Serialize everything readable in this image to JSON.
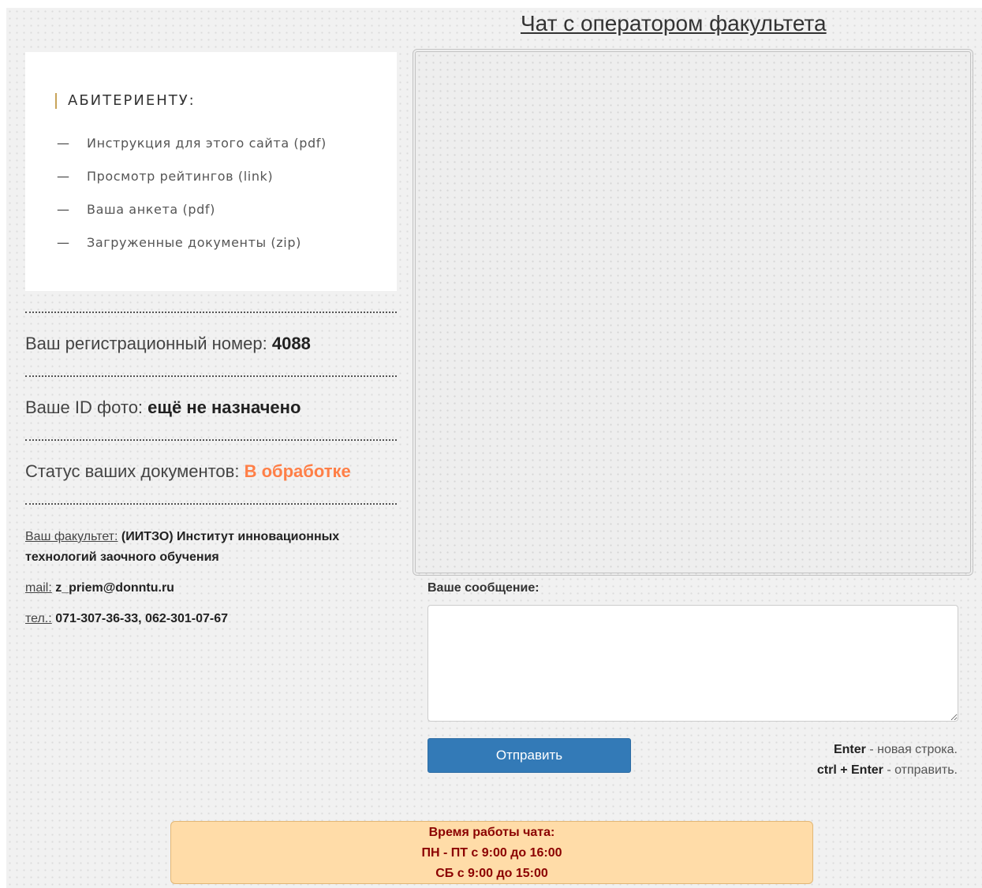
{
  "chat": {
    "title": "Чат с оператором факультета",
    "message_label": "Ваше сообщение:",
    "message_value": "",
    "send_label": "Отправить",
    "hints": [
      {
        "key": "Enter",
        "text": " - новая строка."
      },
      {
        "key": "ctrl + Enter",
        "text": " - отправить."
      }
    ]
  },
  "menu": {
    "heading": "АБИТЕРИЕНТУ:",
    "dash": "—",
    "items": [
      {
        "label": "Инструкция для этого сайта (pdf)"
      },
      {
        "label": "Просмотр рейтингов (link)"
      },
      {
        "label": "Ваша анкета (pdf)"
      },
      {
        "label": "Загруженные документы (zip)"
      }
    ]
  },
  "applicant": {
    "reg_label": "Ваш регистрационный номер: ",
    "reg_value": "4088",
    "photo_label": "Ваше ID фото: ",
    "photo_value": "ещё не назначено",
    "status_label": "Статус ваших документов: ",
    "status_value": "В обработке",
    "faculty_label": "Ваш факультет:",
    "faculty_value": " (ИИТЗО) Институт инновационных технологий заочного обучения",
    "mail_label": "mail:",
    "mail_value": " z_priem@donntu.ru",
    "phone_label": "тел.:",
    "phone_value": " 071-307-36-33, 062-301-07-67"
  },
  "hours": {
    "title": "Время работы чата:",
    "weekdays": "ПН - ПТ с 9:00 до 16:00",
    "saturday": "СБ с 9:00 до 15:00"
  },
  "colors": {
    "status": "#ff7f47",
    "button": "#337ab7",
    "hours_bg": "#ffdca8",
    "hours_text": "#8b0000",
    "heading_bar": "#c8a45a"
  }
}
